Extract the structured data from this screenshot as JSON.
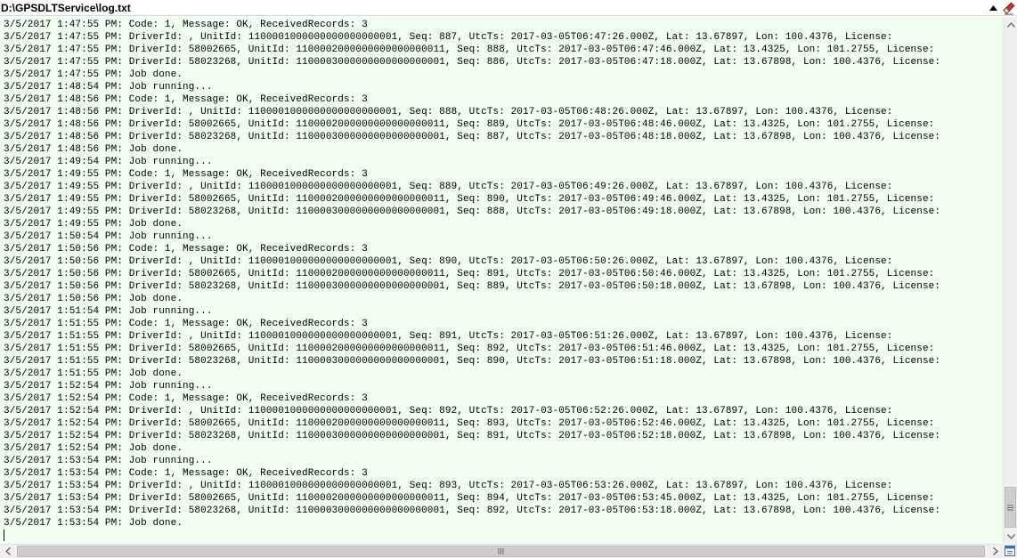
{
  "window": {
    "title": "D:\\GPSDLTService\\log.txt"
  },
  "icons": {
    "collapse": "triangle-up-icon",
    "eraser": "eraser-icon",
    "scroll_up": "chevron-up-icon",
    "scroll_down": "chevron-down-icon",
    "scroll_left": "chevron-left-icon",
    "scroll_right": "chevron-right-icon",
    "grip": "grip-icon",
    "panel_toggle": "panel-toggle-icon"
  },
  "colors": {
    "log_background": "#f0fff0",
    "eraser_accent": "#c0392b"
  },
  "log": {
    "lines": [
      "3/5/2017 1:47:55 PM: Code: 1, Message: OK, ReceivedRecords: 3",
      "3/5/2017 1:47:55 PM: DriverId: , UnitId: 1100001000000000000000001, Seq: 887, UtcTs: 2017-03-05T06:47:26.000Z, Lat: 13.67897, Lon: 100.4376, License:",
      "3/5/2017 1:47:55 PM: DriverId: 58002665, UnitId: 1100002000000000000000011, Seq: 888, UtcTs: 2017-03-05T06:47:46.000Z, Lat: 13.4325, Lon: 101.2755, License:",
      "3/5/2017 1:47:55 PM: DriverId: 58023268, UnitId: 1100003000000000000000001, Seq: 886, UtcTs: 2017-03-05T06:47:18.000Z, Lat: 13.67898, Lon: 100.4376, License:",
      "3/5/2017 1:47:55 PM: Job done.",
      "3/5/2017 1:48:54 PM: Job running...",
      "3/5/2017 1:48:56 PM: Code: 1, Message: OK, ReceivedRecords: 3",
      "3/5/2017 1:48:56 PM: DriverId: , UnitId: 1100001000000000000000001, Seq: 888, UtcTs: 2017-03-05T06:48:26.000Z, Lat: 13.67897, Lon: 100.4376, License:",
      "3/5/2017 1:48:56 PM: DriverId: 58002665, UnitId: 1100002000000000000000011, Seq: 889, UtcTs: 2017-03-05T06:48:46.000Z, Lat: 13.4325, Lon: 101.2755, License:",
      "3/5/2017 1:48:56 PM: DriverId: 58023268, UnitId: 1100003000000000000000001, Seq: 887, UtcTs: 2017-03-05T06:48:18.000Z, Lat: 13.67898, Lon: 100.4376, License:",
      "3/5/2017 1:48:56 PM: Job done.",
      "3/5/2017 1:49:54 PM: Job running...",
      "3/5/2017 1:49:55 PM: Code: 1, Message: OK, ReceivedRecords: 3",
      "3/5/2017 1:49:55 PM: DriverId: , UnitId: 1100001000000000000000001, Seq: 889, UtcTs: 2017-03-05T06:49:26.000Z, Lat: 13.67897, Lon: 100.4376, License:",
      "3/5/2017 1:49:55 PM: DriverId: 58002665, UnitId: 1100002000000000000000011, Seq: 890, UtcTs: 2017-03-05T06:49:46.000Z, Lat: 13.4325, Lon: 101.2755, License:",
      "3/5/2017 1:49:55 PM: DriverId: 58023268, UnitId: 1100003000000000000000001, Seq: 888, UtcTs: 2017-03-05T06:49:18.000Z, Lat: 13.67898, Lon: 100.4376, License:",
      "3/5/2017 1:49:55 PM: Job done.",
      "3/5/2017 1:50:54 PM: Job running...",
      "3/5/2017 1:50:56 PM: Code: 1, Message: OK, ReceivedRecords: 3",
      "3/5/2017 1:50:56 PM: DriverId: , UnitId: 1100001000000000000000001, Seq: 890, UtcTs: 2017-03-05T06:50:26.000Z, Lat: 13.67897, Lon: 100.4376, License:",
      "3/5/2017 1:50:56 PM: DriverId: 58002665, UnitId: 1100002000000000000000011, Seq: 891, UtcTs: 2017-03-05T06:50:46.000Z, Lat: 13.4325, Lon: 101.2755, License:",
      "3/5/2017 1:50:56 PM: DriverId: 58023268, UnitId: 1100003000000000000000001, Seq: 889, UtcTs: 2017-03-05T06:50:18.000Z, Lat: 13.67898, Lon: 100.4376, License:",
      "3/5/2017 1:50:56 PM: Job done.",
      "3/5/2017 1:51:54 PM: Job running...",
      "3/5/2017 1:51:55 PM: Code: 1, Message: OK, ReceivedRecords: 3",
      "3/5/2017 1:51:55 PM: DriverId: , UnitId: 1100001000000000000000001, Seq: 891, UtcTs: 2017-03-05T06:51:26.000Z, Lat: 13.67897, Lon: 100.4376, License:",
      "3/5/2017 1:51:55 PM: DriverId: 58002665, UnitId: 1100002000000000000000011, Seq: 892, UtcTs: 2017-03-05T06:51:46.000Z, Lat: 13.4325, Lon: 101.2755, License:",
      "3/5/2017 1:51:55 PM: DriverId: 58023268, UnitId: 1100003000000000000000001, Seq: 890, UtcTs: 2017-03-05T06:51:18.000Z, Lat: 13.67898, Lon: 100.4376, License:",
      "3/5/2017 1:51:55 PM: Job done.",
      "3/5/2017 1:52:54 PM: Job running...",
      "3/5/2017 1:52:54 PM: Code: 1, Message: OK, ReceivedRecords: 3",
      "3/5/2017 1:52:54 PM: DriverId: , UnitId: 1100001000000000000000001, Seq: 892, UtcTs: 2017-03-05T06:52:26.000Z, Lat: 13.67897, Lon: 100.4376, License:",
      "3/5/2017 1:52:54 PM: DriverId: 58002665, UnitId: 1100002000000000000000011, Seq: 893, UtcTs: 2017-03-05T06:52:46.000Z, Lat: 13.4325, Lon: 101.2755, License:",
      "3/5/2017 1:52:54 PM: DriverId: 58023268, UnitId: 1100003000000000000000001, Seq: 891, UtcTs: 2017-03-05T06:52:18.000Z, Lat: 13.67898, Lon: 100.4376, License:",
      "3/5/2017 1:52:54 PM: Job done.",
      "3/5/2017 1:53:54 PM: Job running...",
      "3/5/2017 1:53:54 PM: Code: 1, Message: OK, ReceivedRecords: 3",
      "3/5/2017 1:53:54 PM: DriverId: , UnitId: 1100001000000000000000001, Seq: 893, UtcTs: 2017-03-05T06:53:26.000Z, Lat: 13.67897, Lon: 100.4376, License:",
      "3/5/2017 1:53:54 PM: DriverId: 58002665, UnitId: 1100002000000000000000011, Seq: 894, UtcTs: 2017-03-05T06:53:45.000Z, Lat: 13.4325, Lon: 101.2755, License:",
      "3/5/2017 1:53:54 PM: DriverId: 58023268, UnitId: 1100003000000000000000001, Seq: 892, UtcTs: 2017-03-05T06:53:18.000Z, Lat: 13.67898, Lon: 100.4376, License:",
      "3/5/2017 1:53:54 PM: Job done."
    ]
  }
}
